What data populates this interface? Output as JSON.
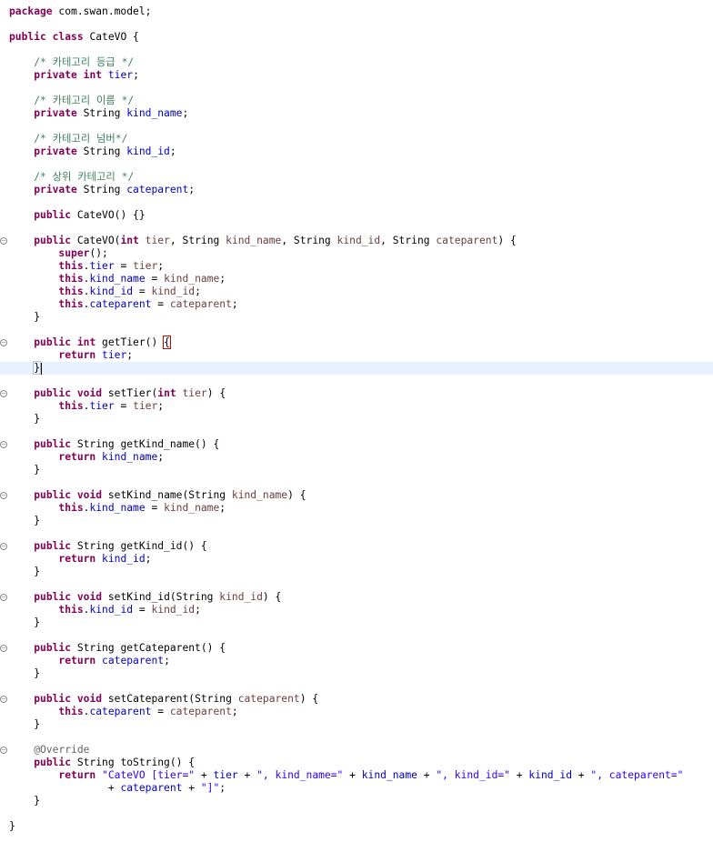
{
  "editor": {
    "lines": [
      {
        "tokens": [
          {
            "t": "package",
            "c": "kw"
          },
          {
            "t": " com.swan.model;",
            "c": "txt"
          }
        ]
      },
      {
        "tokens": []
      },
      {
        "tokens": [
          {
            "t": "public",
            "c": "kw"
          },
          {
            "t": " ",
            "c": "txt"
          },
          {
            "t": "class",
            "c": "kw"
          },
          {
            "t": " CateVO {",
            "c": "txt"
          }
        ]
      },
      {
        "tokens": []
      },
      {
        "tokens": [
          {
            "t": "    /* 카테고리 등급 */",
            "c": "cmt"
          }
        ]
      },
      {
        "tokens": [
          {
            "t": "    ",
            "c": "txt"
          },
          {
            "t": "private",
            "c": "kw"
          },
          {
            "t": " ",
            "c": "txt"
          },
          {
            "t": "int",
            "c": "kw"
          },
          {
            "t": " ",
            "c": "txt"
          },
          {
            "t": "tier",
            "c": "fld"
          },
          {
            "t": ";",
            "c": "txt"
          }
        ]
      },
      {
        "tokens": []
      },
      {
        "tokens": [
          {
            "t": "    /* 카테고리 이름 */",
            "c": "cmt"
          }
        ]
      },
      {
        "tokens": [
          {
            "t": "    ",
            "c": "txt"
          },
          {
            "t": "private",
            "c": "kw"
          },
          {
            "t": " String ",
            "c": "txt"
          },
          {
            "t": "kind_name",
            "c": "fld"
          },
          {
            "t": ";",
            "c": "txt"
          }
        ]
      },
      {
        "tokens": []
      },
      {
        "tokens": [
          {
            "t": "    /* 카테고리 넘버*/",
            "c": "cmt"
          }
        ]
      },
      {
        "tokens": [
          {
            "t": "    ",
            "c": "txt"
          },
          {
            "t": "private",
            "c": "kw"
          },
          {
            "t": " String ",
            "c": "txt"
          },
          {
            "t": "kind_id",
            "c": "fld"
          },
          {
            "t": ";",
            "c": "txt"
          }
        ]
      },
      {
        "tokens": []
      },
      {
        "tokens": [
          {
            "t": "    /* 상위 카테고리 */",
            "c": "cmt"
          }
        ]
      },
      {
        "tokens": [
          {
            "t": "    ",
            "c": "txt"
          },
          {
            "t": "private",
            "c": "kw"
          },
          {
            "t": " String ",
            "c": "txt"
          },
          {
            "t": "cateparent",
            "c": "fld"
          },
          {
            "t": ";",
            "c": "txt"
          }
        ]
      },
      {
        "tokens": []
      },
      {
        "tokens": [
          {
            "t": "    ",
            "c": "txt"
          },
          {
            "t": "public",
            "c": "kw"
          },
          {
            "t": " CateVO() {}",
            "c": "txt"
          }
        ]
      },
      {
        "tokens": []
      },
      {
        "fold": true,
        "tokens": [
          {
            "t": "    ",
            "c": "txt"
          },
          {
            "t": "public",
            "c": "kw"
          },
          {
            "t": " CateVO(",
            "c": "txt"
          },
          {
            "t": "int",
            "c": "kw"
          },
          {
            "t": " ",
            "c": "txt"
          },
          {
            "t": "tier",
            "c": "prm"
          },
          {
            "t": ", String ",
            "c": "txt"
          },
          {
            "t": "kind_name",
            "c": "prm"
          },
          {
            "t": ", String ",
            "c": "txt"
          },
          {
            "t": "kind_id",
            "c": "prm"
          },
          {
            "t": ", String ",
            "c": "txt"
          },
          {
            "t": "cateparent",
            "c": "prm"
          },
          {
            "t": ") {",
            "c": "txt"
          }
        ]
      },
      {
        "tokens": [
          {
            "t": "        ",
            "c": "txt"
          },
          {
            "t": "super",
            "c": "kw"
          },
          {
            "t": "();",
            "c": "txt"
          }
        ]
      },
      {
        "tokens": [
          {
            "t": "        ",
            "c": "txt"
          },
          {
            "t": "this",
            "c": "kw"
          },
          {
            "t": ".",
            "c": "txt"
          },
          {
            "t": "tier",
            "c": "fld"
          },
          {
            "t": " = ",
            "c": "txt"
          },
          {
            "t": "tier",
            "c": "prm"
          },
          {
            "t": ";",
            "c": "txt"
          }
        ]
      },
      {
        "tokens": [
          {
            "t": "        ",
            "c": "txt"
          },
          {
            "t": "this",
            "c": "kw"
          },
          {
            "t": ".",
            "c": "txt"
          },
          {
            "t": "kind_name",
            "c": "fld"
          },
          {
            "t": " = ",
            "c": "txt"
          },
          {
            "t": "kind_name",
            "c": "prm"
          },
          {
            "t": ";",
            "c": "txt"
          }
        ]
      },
      {
        "tokens": [
          {
            "t": "        ",
            "c": "txt"
          },
          {
            "t": "this",
            "c": "kw"
          },
          {
            "t": ".",
            "c": "txt"
          },
          {
            "t": "kind_id",
            "c": "fld"
          },
          {
            "t": " = ",
            "c": "txt"
          },
          {
            "t": "kind_id",
            "c": "prm"
          },
          {
            "t": ";",
            "c": "txt"
          }
        ]
      },
      {
        "tokens": [
          {
            "t": "        ",
            "c": "txt"
          },
          {
            "t": "this",
            "c": "kw"
          },
          {
            "t": ".",
            "c": "txt"
          },
          {
            "t": "cateparent",
            "c": "fld"
          },
          {
            "t": " = ",
            "c": "txt"
          },
          {
            "t": "cateparent",
            "c": "prm"
          },
          {
            "t": ";",
            "c": "txt"
          }
        ]
      },
      {
        "tokens": [
          {
            "t": "    }",
            "c": "txt"
          }
        ]
      },
      {
        "tokens": []
      },
      {
        "fold": true,
        "tokens": [
          {
            "t": "    ",
            "c": "txt"
          },
          {
            "t": "public",
            "c": "kw"
          },
          {
            "t": " ",
            "c": "txt"
          },
          {
            "t": "int",
            "c": "kw"
          },
          {
            "t": " getTier() ",
            "c": "txt"
          },
          {
            "t": "{",
            "c": "redbox"
          }
        ]
      },
      {
        "tokens": [
          {
            "t": "        ",
            "c": "txt"
          },
          {
            "t": "return",
            "c": "kw"
          },
          {
            "t": " ",
            "c": "txt"
          },
          {
            "t": "tier",
            "c": "fld"
          },
          {
            "t": ";",
            "c": "txt"
          }
        ]
      },
      {
        "current": true,
        "caret": true,
        "tokens": [
          {
            "t": "    ",
            "c": "txt"
          },
          {
            "t": "}",
            "c": "bracket"
          }
        ]
      },
      {
        "tokens": []
      },
      {
        "fold": true,
        "tokens": [
          {
            "t": "    ",
            "c": "txt"
          },
          {
            "t": "public",
            "c": "kw"
          },
          {
            "t": " ",
            "c": "txt"
          },
          {
            "t": "void",
            "c": "kw"
          },
          {
            "t": " setTier(",
            "c": "txt"
          },
          {
            "t": "int",
            "c": "kw"
          },
          {
            "t": " ",
            "c": "txt"
          },
          {
            "t": "tier",
            "c": "prm"
          },
          {
            "t": ") {",
            "c": "txt"
          }
        ]
      },
      {
        "tokens": [
          {
            "t": "        ",
            "c": "txt"
          },
          {
            "t": "this",
            "c": "kw"
          },
          {
            "t": ".",
            "c": "txt"
          },
          {
            "t": "tier",
            "c": "fld"
          },
          {
            "t": " = ",
            "c": "txt"
          },
          {
            "t": "tier",
            "c": "prm"
          },
          {
            "t": ";",
            "c": "txt"
          }
        ]
      },
      {
        "tokens": [
          {
            "t": "    }",
            "c": "txt"
          }
        ]
      },
      {
        "tokens": []
      },
      {
        "fold": true,
        "tokens": [
          {
            "t": "    ",
            "c": "txt"
          },
          {
            "t": "public",
            "c": "kw"
          },
          {
            "t": " String getKind_name() {",
            "c": "txt"
          }
        ]
      },
      {
        "tokens": [
          {
            "t": "        ",
            "c": "txt"
          },
          {
            "t": "return",
            "c": "kw"
          },
          {
            "t": " ",
            "c": "txt"
          },
          {
            "t": "kind_name",
            "c": "fld"
          },
          {
            "t": ";",
            "c": "txt"
          }
        ]
      },
      {
        "tokens": [
          {
            "t": "    }",
            "c": "txt"
          }
        ]
      },
      {
        "tokens": []
      },
      {
        "fold": true,
        "tokens": [
          {
            "t": "    ",
            "c": "txt"
          },
          {
            "t": "public",
            "c": "kw"
          },
          {
            "t": " ",
            "c": "txt"
          },
          {
            "t": "void",
            "c": "kw"
          },
          {
            "t": " setKind_name(String ",
            "c": "txt"
          },
          {
            "t": "kind_name",
            "c": "prm"
          },
          {
            "t": ") {",
            "c": "txt"
          }
        ]
      },
      {
        "tokens": [
          {
            "t": "        ",
            "c": "txt"
          },
          {
            "t": "this",
            "c": "kw"
          },
          {
            "t": ".",
            "c": "txt"
          },
          {
            "t": "kind_name",
            "c": "fld"
          },
          {
            "t": " = ",
            "c": "txt"
          },
          {
            "t": "kind_name",
            "c": "prm"
          },
          {
            "t": ";",
            "c": "txt"
          }
        ]
      },
      {
        "tokens": [
          {
            "t": "    }",
            "c": "txt"
          }
        ]
      },
      {
        "tokens": []
      },
      {
        "fold": true,
        "tokens": [
          {
            "t": "    ",
            "c": "txt"
          },
          {
            "t": "public",
            "c": "kw"
          },
          {
            "t": " String getKind_id() {",
            "c": "txt"
          }
        ]
      },
      {
        "tokens": [
          {
            "t": "        ",
            "c": "txt"
          },
          {
            "t": "return",
            "c": "kw"
          },
          {
            "t": " ",
            "c": "txt"
          },
          {
            "t": "kind_id",
            "c": "fld"
          },
          {
            "t": ";",
            "c": "txt"
          }
        ]
      },
      {
        "tokens": [
          {
            "t": "    }",
            "c": "txt"
          }
        ]
      },
      {
        "tokens": []
      },
      {
        "fold": true,
        "tokens": [
          {
            "t": "    ",
            "c": "txt"
          },
          {
            "t": "public",
            "c": "kw"
          },
          {
            "t": " ",
            "c": "txt"
          },
          {
            "t": "void",
            "c": "kw"
          },
          {
            "t": " setKind_id(String ",
            "c": "txt"
          },
          {
            "t": "kind_id",
            "c": "prm"
          },
          {
            "t": ") {",
            "c": "txt"
          }
        ]
      },
      {
        "tokens": [
          {
            "t": "        ",
            "c": "txt"
          },
          {
            "t": "this",
            "c": "kw"
          },
          {
            "t": ".",
            "c": "txt"
          },
          {
            "t": "kind_id",
            "c": "fld"
          },
          {
            "t": " = ",
            "c": "txt"
          },
          {
            "t": "kind_id",
            "c": "prm"
          },
          {
            "t": ";",
            "c": "txt"
          }
        ]
      },
      {
        "tokens": [
          {
            "t": "    }",
            "c": "txt"
          }
        ]
      },
      {
        "tokens": []
      },
      {
        "fold": true,
        "tokens": [
          {
            "t": "    ",
            "c": "txt"
          },
          {
            "t": "public",
            "c": "kw"
          },
          {
            "t": " String getCateparent() {",
            "c": "txt"
          }
        ]
      },
      {
        "tokens": [
          {
            "t": "        ",
            "c": "txt"
          },
          {
            "t": "return",
            "c": "kw"
          },
          {
            "t": " ",
            "c": "txt"
          },
          {
            "t": "cateparent",
            "c": "fld"
          },
          {
            "t": ";",
            "c": "txt"
          }
        ]
      },
      {
        "tokens": [
          {
            "t": "    }",
            "c": "txt"
          }
        ]
      },
      {
        "tokens": []
      },
      {
        "fold": true,
        "tokens": [
          {
            "t": "    ",
            "c": "txt"
          },
          {
            "t": "public",
            "c": "kw"
          },
          {
            "t": " ",
            "c": "txt"
          },
          {
            "t": "void",
            "c": "kw"
          },
          {
            "t": " setCateparent(String ",
            "c": "txt"
          },
          {
            "t": "cateparent",
            "c": "prm"
          },
          {
            "t": ") {",
            "c": "txt"
          }
        ]
      },
      {
        "tokens": [
          {
            "t": "        ",
            "c": "txt"
          },
          {
            "t": "this",
            "c": "kw"
          },
          {
            "t": ".",
            "c": "txt"
          },
          {
            "t": "cateparent",
            "c": "fld"
          },
          {
            "t": " = ",
            "c": "txt"
          },
          {
            "t": "cateparent",
            "c": "prm"
          },
          {
            "t": ";",
            "c": "txt"
          }
        ]
      },
      {
        "tokens": [
          {
            "t": "    }",
            "c": "txt"
          }
        ]
      },
      {
        "tokens": []
      },
      {
        "fold": true,
        "tokens": [
          {
            "t": "    @Override",
            "c": "ann"
          }
        ]
      },
      {
        "tokens": [
          {
            "t": "    ",
            "c": "txt"
          },
          {
            "t": "public",
            "c": "kw"
          },
          {
            "t": " String toString() {",
            "c": "txt"
          }
        ]
      },
      {
        "tokens": [
          {
            "t": "        ",
            "c": "txt"
          },
          {
            "t": "return",
            "c": "kw"
          },
          {
            "t": " ",
            "c": "txt"
          },
          {
            "t": "\"CateVO [tier=\"",
            "c": "str"
          },
          {
            "t": " + ",
            "c": "txt"
          },
          {
            "t": "tier",
            "c": "fld"
          },
          {
            "t": " + ",
            "c": "txt"
          },
          {
            "t": "\", kind_name=\"",
            "c": "str"
          },
          {
            "t": " + ",
            "c": "txt"
          },
          {
            "t": "kind_name",
            "c": "fld"
          },
          {
            "t": " + ",
            "c": "txt"
          },
          {
            "t": "\", kind_id=\"",
            "c": "str"
          },
          {
            "t": " + ",
            "c": "txt"
          },
          {
            "t": "kind_id",
            "c": "fld"
          },
          {
            "t": " + ",
            "c": "txt"
          },
          {
            "t": "\", cateparent=\"",
            "c": "str"
          }
        ]
      },
      {
        "tokens": [
          {
            "t": "                + ",
            "c": "txt"
          },
          {
            "t": "cateparent",
            "c": "fld"
          },
          {
            "t": " + ",
            "c": "txt"
          },
          {
            "t": "\"]\"",
            "c": "str"
          },
          {
            "t": ";",
            "c": "txt"
          }
        ]
      },
      {
        "tokens": [
          {
            "t": "    }",
            "c": "txt"
          }
        ]
      },
      {
        "tokens": []
      },
      {
        "tokens": [
          {
            "t": "}",
            "c": "txt"
          }
        ]
      }
    ]
  },
  "colors": {
    "keyword": "#7f0055",
    "field": "#0000c0",
    "parameter": "#6a3e3e",
    "string": "#2a00ff",
    "comment": "#3f7f5f",
    "annotation": "#646464",
    "current_line": "#e8f2fe"
  }
}
